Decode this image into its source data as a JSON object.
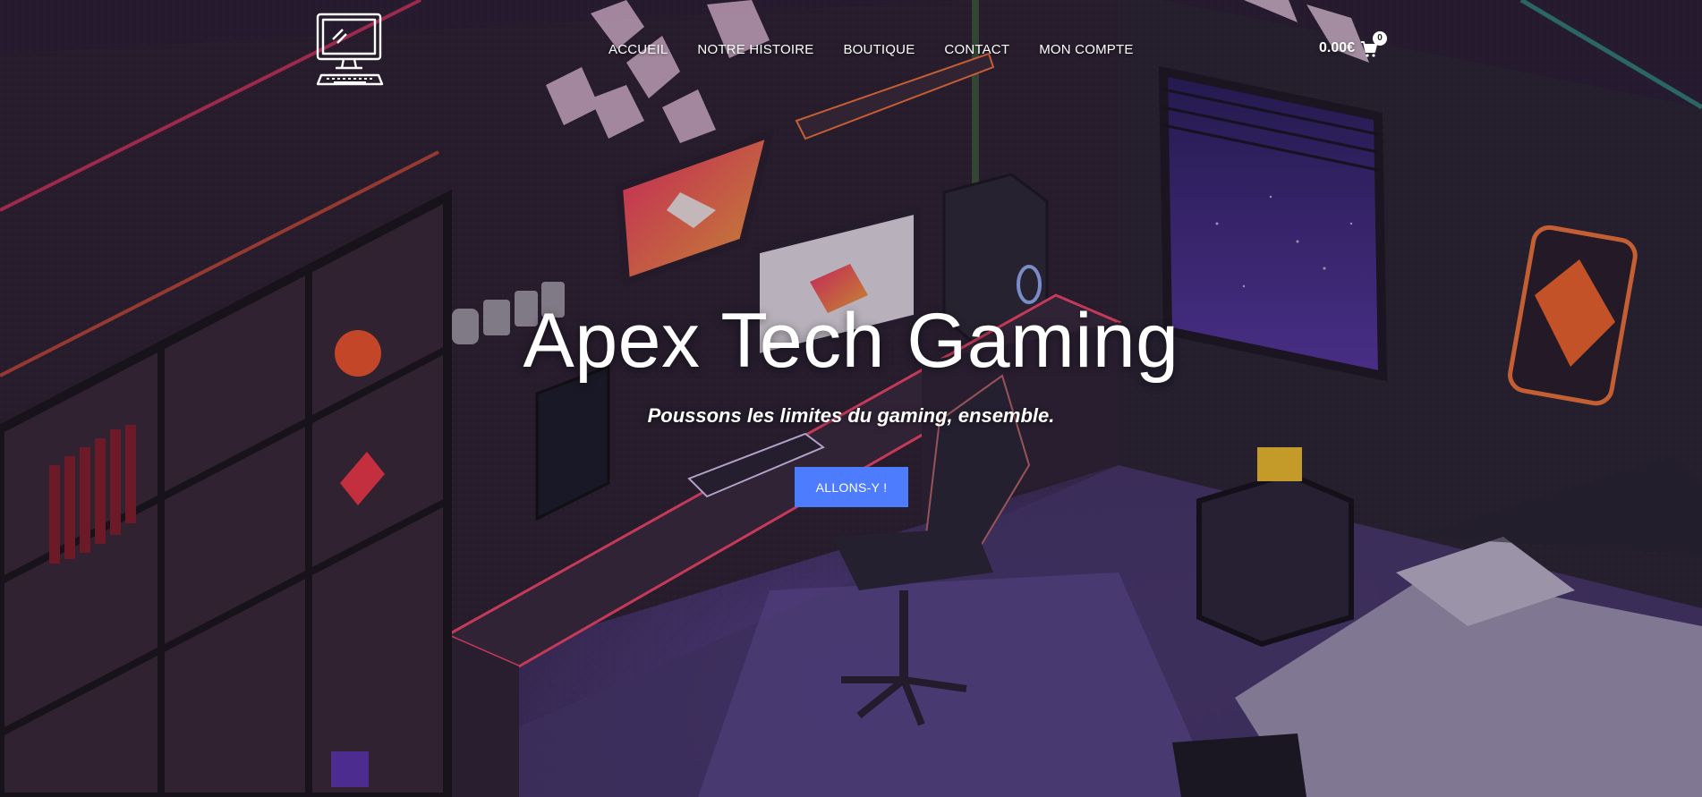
{
  "header": {
    "logo_icon": "computer-monitor-keyboard-icon",
    "nav": [
      {
        "label": "ACCUEIL"
      },
      {
        "label": "NOTRE HISTOIRE"
      },
      {
        "label": "BOUTIQUE"
      },
      {
        "label": "CONTACT"
      },
      {
        "label": "MON COMPTE"
      }
    ],
    "cart": {
      "total": "0.00€",
      "count": "0",
      "icon": "shopping-cart-icon"
    }
  },
  "hero": {
    "title": "Apex Tech Gaming",
    "subtitle": "Poussons les limites du gaming, ensemble.",
    "cta_label": "ALLONS-Y !",
    "background": "isometric-gaming-room-illustration",
    "colors": {
      "cta": "#4d7cfe",
      "text": "#ffffff"
    }
  }
}
